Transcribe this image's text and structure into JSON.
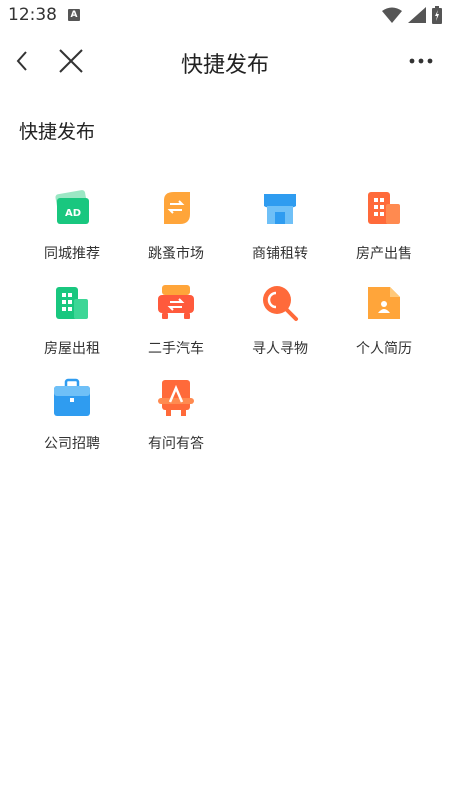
{
  "status_bar": {
    "time": "12:38",
    "notification_icon_text": "A"
  },
  "nav": {
    "title": "快捷发布"
  },
  "section": {
    "title": "快捷发布"
  },
  "items": [
    {
      "label": "同城推荐",
      "icon": "ad-card-icon",
      "color": "#19c77f"
    },
    {
      "label": "跳蚤市场",
      "icon": "exchange-leaf-icon",
      "color": "#ffa53a"
    },
    {
      "label": "商铺租转",
      "icon": "storefront-icon",
      "color": "#2f9cf0"
    },
    {
      "label": "房产出售",
      "icon": "building-icon",
      "color": "#ff6a3a"
    },
    {
      "label": "房屋出租",
      "icon": "apartment-icon",
      "color": "#19c77f"
    },
    {
      "label": "二手汽车",
      "icon": "car-icon",
      "color": "#ff5a3c"
    },
    {
      "label": "寻人寻物",
      "icon": "search-icon",
      "color": "#ff6a3a"
    },
    {
      "label": "个人简历",
      "icon": "resume-icon",
      "color": "#ffa53a"
    },
    {
      "label": "公司招聘",
      "icon": "briefcase-icon",
      "color": "#2f9cf0"
    },
    {
      "label": "有问有答",
      "icon": "qa-icon",
      "color": "#ff6a3a"
    }
  ]
}
